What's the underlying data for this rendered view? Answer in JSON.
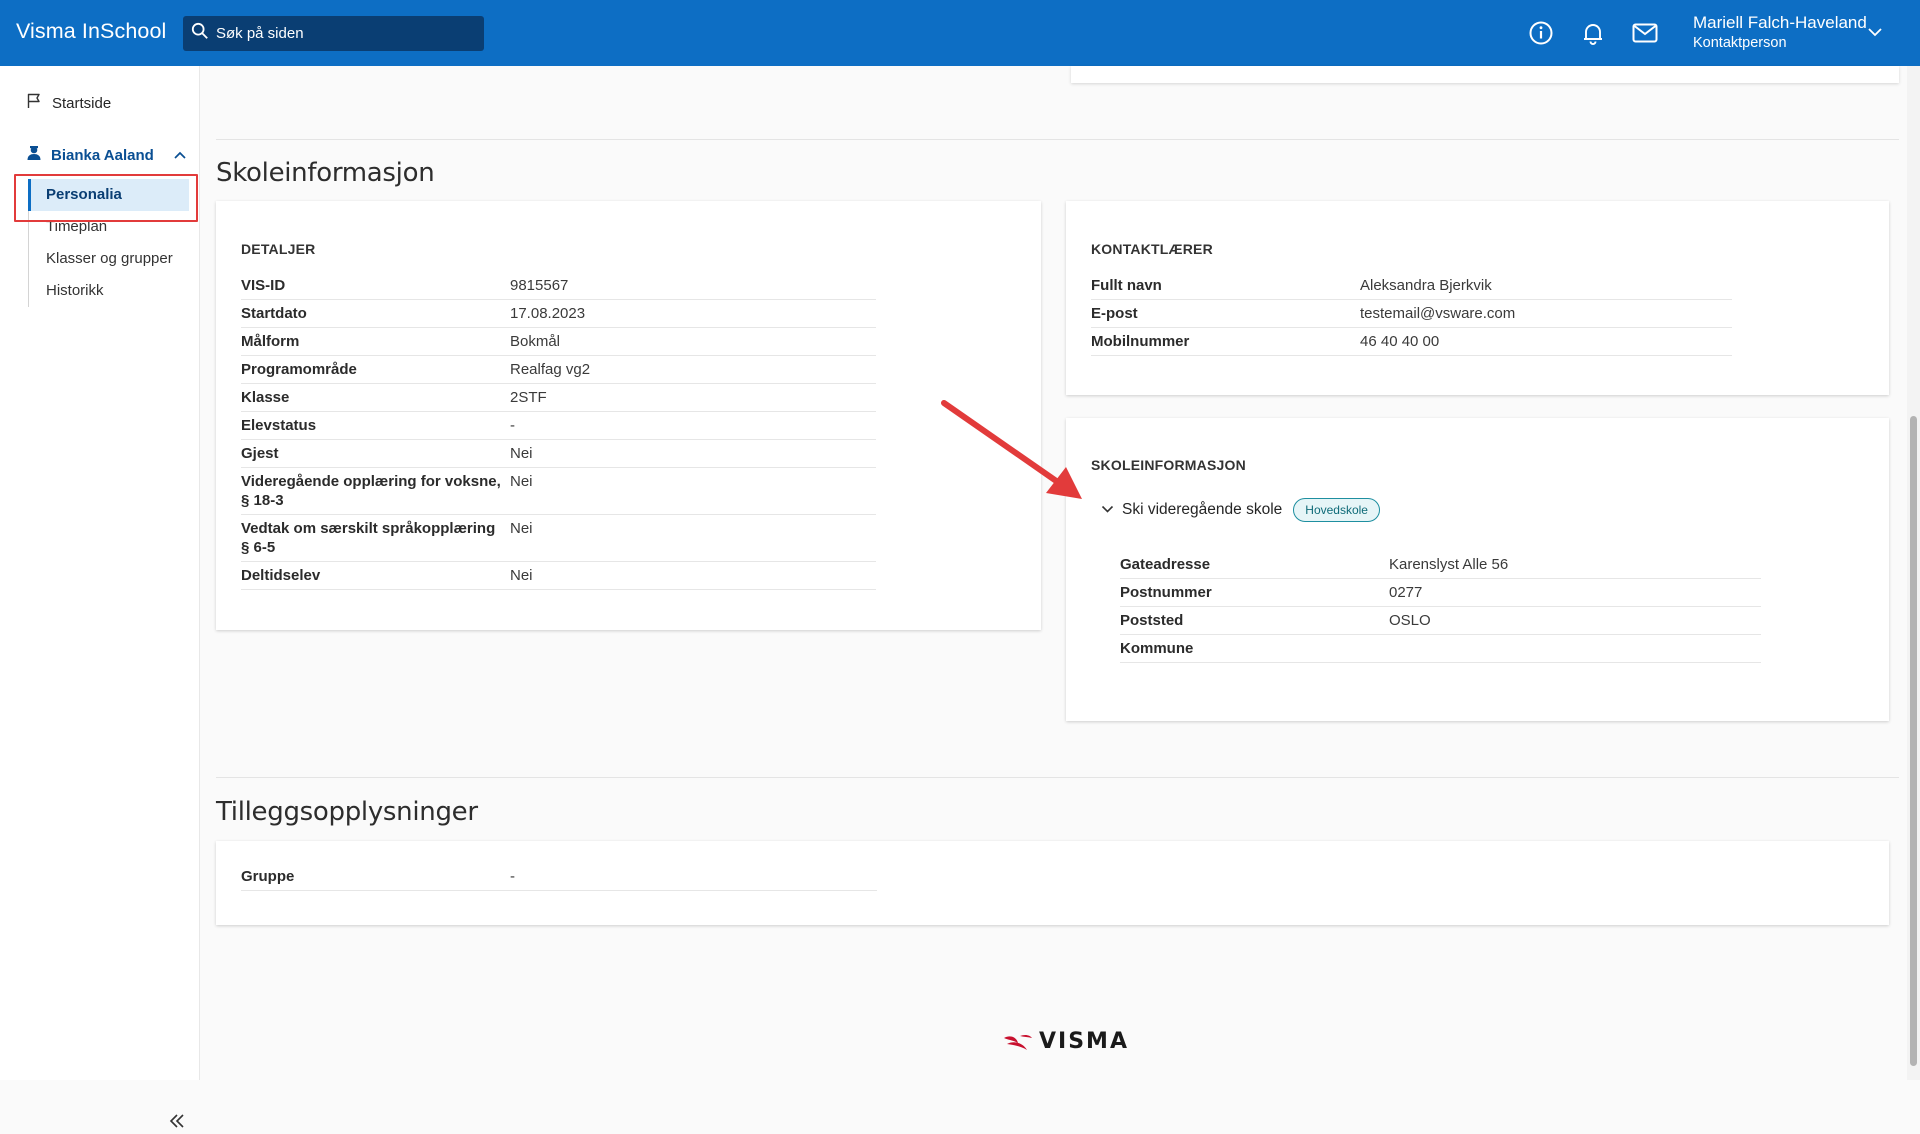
{
  "app": {
    "title": "Visma InSchool"
  },
  "search": {
    "placeholder": "Søk på siden"
  },
  "header_icons": [
    "info-icon",
    "bell-icon",
    "mail-icon"
  ],
  "user": {
    "name": "Mariell Falch-Haveland",
    "role": "Kontaktperson"
  },
  "sidebar": {
    "home": "Startside",
    "student": "Bianka Aaland",
    "items": [
      {
        "label": "Personalia",
        "active": true
      },
      {
        "label": "Timeplan",
        "active": false
      },
      {
        "label": "Klasser og grupper",
        "active": false
      },
      {
        "label": "Historikk",
        "active": false
      }
    ]
  },
  "school_section": {
    "title": "Skoleinformasjon",
    "details": {
      "heading": "DETALJER",
      "rows": [
        {
          "label": "VIS-ID",
          "value": "9815567"
        },
        {
          "label": "Startdato",
          "value": "17.08.2023"
        },
        {
          "label": "Målform",
          "value": "Bokmål"
        },
        {
          "label": "Programområde",
          "value": "Realfag vg2"
        },
        {
          "label": "Klasse",
          "value": "2STF"
        },
        {
          "label": "Elevstatus",
          "value": "-"
        },
        {
          "label": "Gjest",
          "value": "Nei"
        },
        {
          "label": "Videregående opplæring for voksne, § 18-3",
          "value": "Nei"
        },
        {
          "label": "Vedtak om særskilt språkopplæring § 6-5",
          "value": "Nei"
        },
        {
          "label": "Deltidselev",
          "value": "Nei"
        }
      ]
    },
    "contact_teacher": {
      "heading": "KONTAKTLÆRER",
      "rows": [
        {
          "label": "Fullt navn",
          "value": "Aleksandra Bjerkvik"
        },
        {
          "label": "E-post",
          "value": "testemail@vsware.com"
        },
        {
          "label": "Mobilnummer",
          "value": "46 40 40 00"
        }
      ]
    },
    "school_info": {
      "heading": "SKOLEINFORMASJON",
      "school_name": "Ski videregående skole",
      "badge": "Hovedskole",
      "rows": [
        {
          "label": "Gateadresse",
          "value": "Karenslyst Alle 56"
        },
        {
          "label": "Postnummer",
          "value": "0277"
        },
        {
          "label": "Poststed",
          "value": "OSLO"
        },
        {
          "label": "Kommune",
          "value": ""
        }
      ]
    }
  },
  "extra_section": {
    "title": "Tilleggsopplysninger",
    "rows": [
      {
        "label": "Gruppe",
        "value": "-"
      }
    ]
  },
  "footer": {
    "logo_text": "VISMA"
  },
  "colors": {
    "topbar": "#0d6ec4",
    "search_bg": "#0a3e73",
    "annotation": "#e23b3b"
  }
}
